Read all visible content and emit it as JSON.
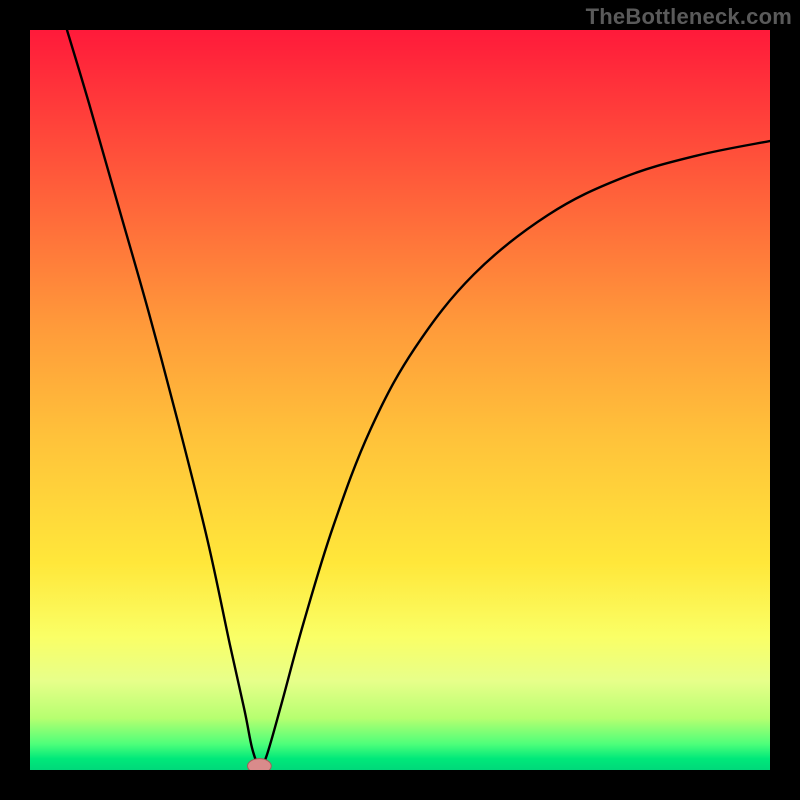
{
  "watermark": "TheBottleneck.com",
  "colors": {
    "frame": "#000000",
    "curve": "#000000",
    "marker_fill": "#d98b8b",
    "marker_stroke": "#a85a5a",
    "gradient_stops": [
      {
        "offset": 0.0,
        "color": "#ff1a3a"
      },
      {
        "offset": 0.2,
        "color": "#ff5a3a"
      },
      {
        "offset": 0.4,
        "color": "#ff9a3a"
      },
      {
        "offset": 0.55,
        "color": "#ffc23a"
      },
      {
        "offset": 0.72,
        "color": "#ffe73a"
      },
      {
        "offset": 0.82,
        "color": "#faff66"
      },
      {
        "offset": 0.88,
        "color": "#e7ff8a"
      },
      {
        "offset": 0.93,
        "color": "#b6ff70"
      },
      {
        "offset": 0.965,
        "color": "#4dff7a"
      },
      {
        "offset": 0.985,
        "color": "#00e87a"
      },
      {
        "offset": 1.0,
        "color": "#00d87a"
      }
    ]
  },
  "chart_data": {
    "type": "line",
    "title": "",
    "xlabel": "",
    "ylabel": "",
    "xlim": [
      0,
      100
    ],
    "ylim": [
      0,
      100
    ],
    "minimum": {
      "x": 31,
      "y": 0
    },
    "left_branch": [
      {
        "x": 5,
        "y": 100
      },
      {
        "x": 8,
        "y": 90
      },
      {
        "x": 12,
        "y": 76
      },
      {
        "x": 16,
        "y": 62
      },
      {
        "x": 20,
        "y": 47
      },
      {
        "x": 24,
        "y": 31
      },
      {
        "x": 27,
        "y": 17
      },
      {
        "x": 29,
        "y": 8
      },
      {
        "x": 30,
        "y": 3
      },
      {
        "x": 31,
        "y": 0
      }
    ],
    "right_branch": [
      {
        "x": 31,
        "y": 0
      },
      {
        "x": 32,
        "y": 2
      },
      {
        "x": 34,
        "y": 9
      },
      {
        "x": 37,
        "y": 20
      },
      {
        "x": 41,
        "y": 33
      },
      {
        "x": 46,
        "y": 46
      },
      {
        "x": 52,
        "y": 57
      },
      {
        "x": 60,
        "y": 67
      },
      {
        "x": 70,
        "y": 75
      },
      {
        "x": 80,
        "y": 80
      },
      {
        "x": 90,
        "y": 83
      },
      {
        "x": 100,
        "y": 85
      }
    ],
    "marker": {
      "x": 31,
      "y": 0,
      "rx": 1.6,
      "ry": 1.0
    }
  }
}
